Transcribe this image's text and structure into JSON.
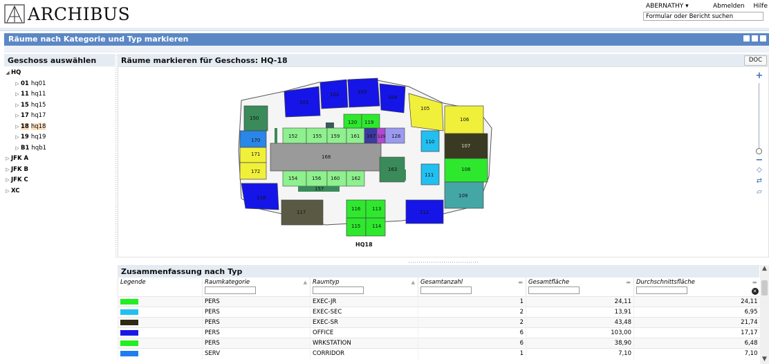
{
  "app": {
    "logo_text": "ARCHIBUS"
  },
  "user": {
    "name": "ABERNATHY ▾",
    "logout": "Abmelden",
    "help": "Hilfe",
    "search_placeholder": "Formular oder Bericht suchen"
  },
  "title_bar": {
    "title": "Räume nach Kategorie und Typ markieren"
  },
  "left": {
    "title": "Geschoss auswählen",
    "buildings": [
      {
        "code": "HQ",
        "floors": [
          {
            "code": "01",
            "name": "hq01"
          },
          {
            "code": "11",
            "name": "hq11"
          },
          {
            "code": "15",
            "name": "hq15"
          },
          {
            "code": "17",
            "name": "hq17"
          },
          {
            "code": "18",
            "name": "hq18"
          },
          {
            "code": "19",
            "name": "hq19"
          },
          {
            "code": "B1",
            "name": "hqb1"
          }
        ]
      },
      {
        "code": "JFK A"
      },
      {
        "code": "JFK B"
      },
      {
        "code": "JFK C"
      },
      {
        "code": "XC"
      }
    ]
  },
  "drawing": {
    "title": "Räume markieren für Geschoss: HQ-18",
    "doc_button": "DOC",
    "floor_label": "HQ18",
    "rooms": [
      "101",
      "102",
      "103",
      "104",
      "105",
      "106",
      "107",
      "108",
      "109",
      "110",
      "111",
      "112",
      "113",
      "114",
      "115",
      "116",
      "117",
      "118",
      "119",
      "120",
      "128",
      "129",
      "150",
      "152",
      "153",
      "154",
      "155",
      "156",
      "159",
      "160",
      "161",
      "162",
      "163",
      "164",
      "167",
      "168",
      "170",
      "171",
      "172",
      "125",
      "157"
    ]
  },
  "summary": {
    "title": "Zusammenfassung nach Typ",
    "columns": [
      "Legende",
      "Raumkategorie",
      "Raumtyp",
      "Gesamtanzahl",
      "Gesamtfläche",
      "Durchschnittsfläche"
    ],
    "rows": [
      {
        "color": "#22ee22",
        "category": "PERS",
        "type": "EXEC-JR",
        "count": "1",
        "area": "24,11",
        "avg": "24,11"
      },
      {
        "color": "#22c0f0",
        "category": "PERS",
        "type": "EXEC-SEC",
        "count": "2",
        "area": "13,91",
        "avg": "6,95"
      },
      {
        "color": "#2e2a14",
        "category": "PERS",
        "type": "EXEC-SR",
        "count": "2",
        "area": "43,48",
        "avg": "21,74"
      },
      {
        "color": "#1818e6",
        "category": "PERS",
        "type": "OFFICE",
        "count": "6",
        "area": "103,00",
        "avg": "17,17"
      },
      {
        "color": "#22ee22",
        "category": "PERS",
        "type": "WRKSTATION",
        "count": "6",
        "area": "38,90",
        "avg": "6,48"
      },
      {
        "color": "#1e7ef0",
        "category": "SERV",
        "type": "CORRIDOR",
        "count": "1",
        "area": "7,10",
        "avg": "7,10"
      }
    ]
  }
}
